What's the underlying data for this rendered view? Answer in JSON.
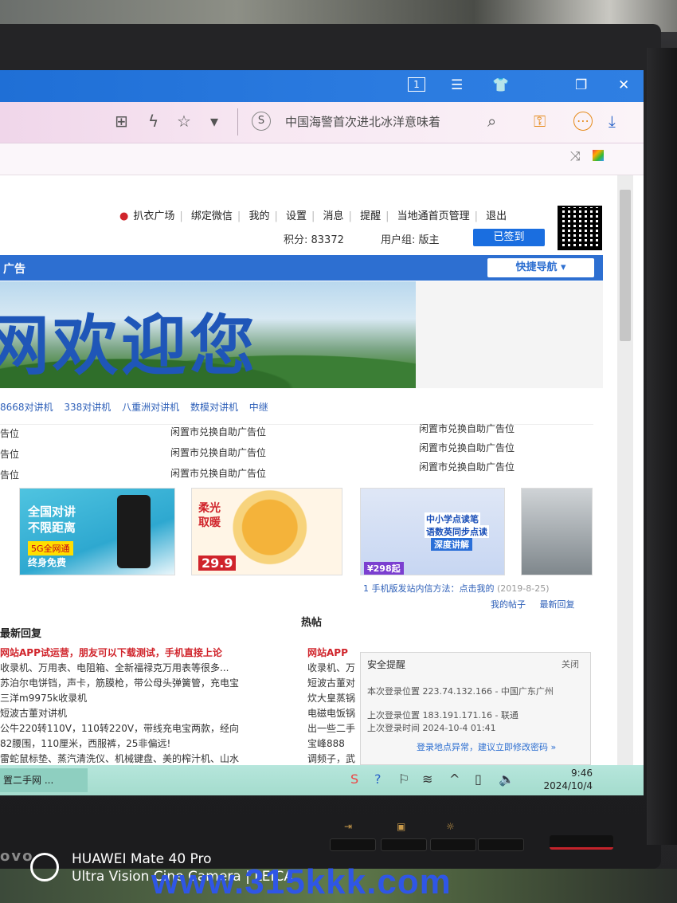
{
  "browser": {
    "titlebar_icons": {
      "tab_count": "1",
      "menu": "☰",
      "skin": "👕",
      "restore": "❐",
      "close": "✕"
    },
    "address_bar": {
      "value": "中国海警首次进北冰洋意味着"
    },
    "toolbar_icons": {
      "qr": "⊞",
      "lightning": "ϟ",
      "star": "☆",
      "dropdown": "▾",
      "search": "⌕",
      "key": "⚿",
      "more": "⋯",
      "download": "⤓"
    }
  },
  "site": {
    "userbar": {
      "flea_market": "扒衣广场",
      "bind_wechat": "绑定微信",
      "my": "我的",
      "settings": "设置",
      "messages": "消息",
      "remind": "提醒",
      "local_admin": "当地通首页管理",
      "logout": "退出"
    },
    "points": "积分: 83372",
    "user_group": "用户组: 版主",
    "signed_button": "已签到",
    "nav_label": "广告",
    "quick_nav": "快捷导航 ▾",
    "banner_text": "网欢迎您",
    "tags": [
      "8668对讲机",
      "338对讲机",
      "八重洲对讲机",
      "数模对讲机",
      "中继"
    ],
    "ad_slots": {
      "left": [
        "告位",
        "告位",
        "告位"
      ],
      "middle": [
        "闲置市兑换自助广告位",
        "闲置市兑换自助广告位",
        "闲置市兑换自助广告位"
      ],
      "right": [
        "闲置市兑换自助广告位",
        "闲置市兑换自助广告位",
        "闲置市兑换自助广告位"
      ]
    },
    "thumbs": {
      "t1": {
        "title": "全国对讲",
        "subtitle": "不限距离",
        "badge": "5G全网通",
        "footer": "终身免费"
      },
      "t2": {
        "title": "柔光",
        "subtitle": "取暖",
        "price": "29.9"
      },
      "t3": {
        "line1": "中小学点读笔",
        "line2": "语数英同步点读",
        "line3": "深度讲解",
        "price": "¥298起"
      },
      "t4": {}
    },
    "mobile_tip": "1 手机版发站内信方法：点击我的",
    "mobile_tip_date": "(2019-8-25)",
    "my_posts": "我的帖子",
    "latest_reply": "最新回复",
    "recent_replies_title": "最新回复",
    "hot_title": "热帖",
    "replies": [
      {
        "hot": true,
        "text": "网站APP试运营，朋友可以下载测试，手机直接上论"
      },
      {
        "hot": false,
        "text": "收录机、万用表、电阻箱、全新福禄克万用表等很多..."
      },
      {
        "hot": false,
        "text": "苏泊尔电饼铛，声卡，筋膜枪，带公母头弹簧管，充电宝"
      },
      {
        "hot": false,
        "text": "三洋m9975k收录机"
      },
      {
        "hot": false,
        "text": "短波古董对讲机"
      },
      {
        "hot": false,
        "text": "公牛220转110V，110转220V，带线充电宝两款，经向"
      },
      {
        "hot": false,
        "text": "82腰围，110厘米，西服裤，25非偏远!"
      },
      {
        "hot": false,
        "text": "雷蛇鼠标垫、蒸汽清洗仪、机械键盘、美的榨汁机、山水"
      }
    ],
    "hot_posts": [
      {
        "hot": true,
        "text": "网站APP"
      },
      {
        "hot": false,
        "text": "收录机、万"
      },
      {
        "hot": false,
        "text": "短波古董对"
      },
      {
        "hot": false,
        "text": "炊大皇蒸锅"
      },
      {
        "hot": false,
        "text": "电磁电饭锅"
      },
      {
        "hot": false,
        "text": "出一些二手"
      },
      {
        "hot": false,
        "text": "宝峰888"
      },
      {
        "hot": false,
        "text": "调频子，武"
      }
    ],
    "security": {
      "title": "安全提醒",
      "close": "关闭",
      "this_login": "本次登录位置 223.74.132.166 - 中国广东广州",
      "last_location": "上次登录位置 183.191.171.16 - 联通",
      "last_time": "上次登录时间 2024-10-4 01:41",
      "link": "登录地点异常，建议立即修改密码 »"
    }
  },
  "taskbar": {
    "task": "置二手网 ...",
    "time": "9:46",
    "date": "2024/10/4"
  },
  "monitor": {
    "brand": "ovo"
  },
  "watermarks": {
    "camera_line1": "HUAWEI Mate 40 Pro",
    "camera_line2": "Ultra Vision Cine Camera | LEICA",
    "site": "www.315kkk.com"
  }
}
